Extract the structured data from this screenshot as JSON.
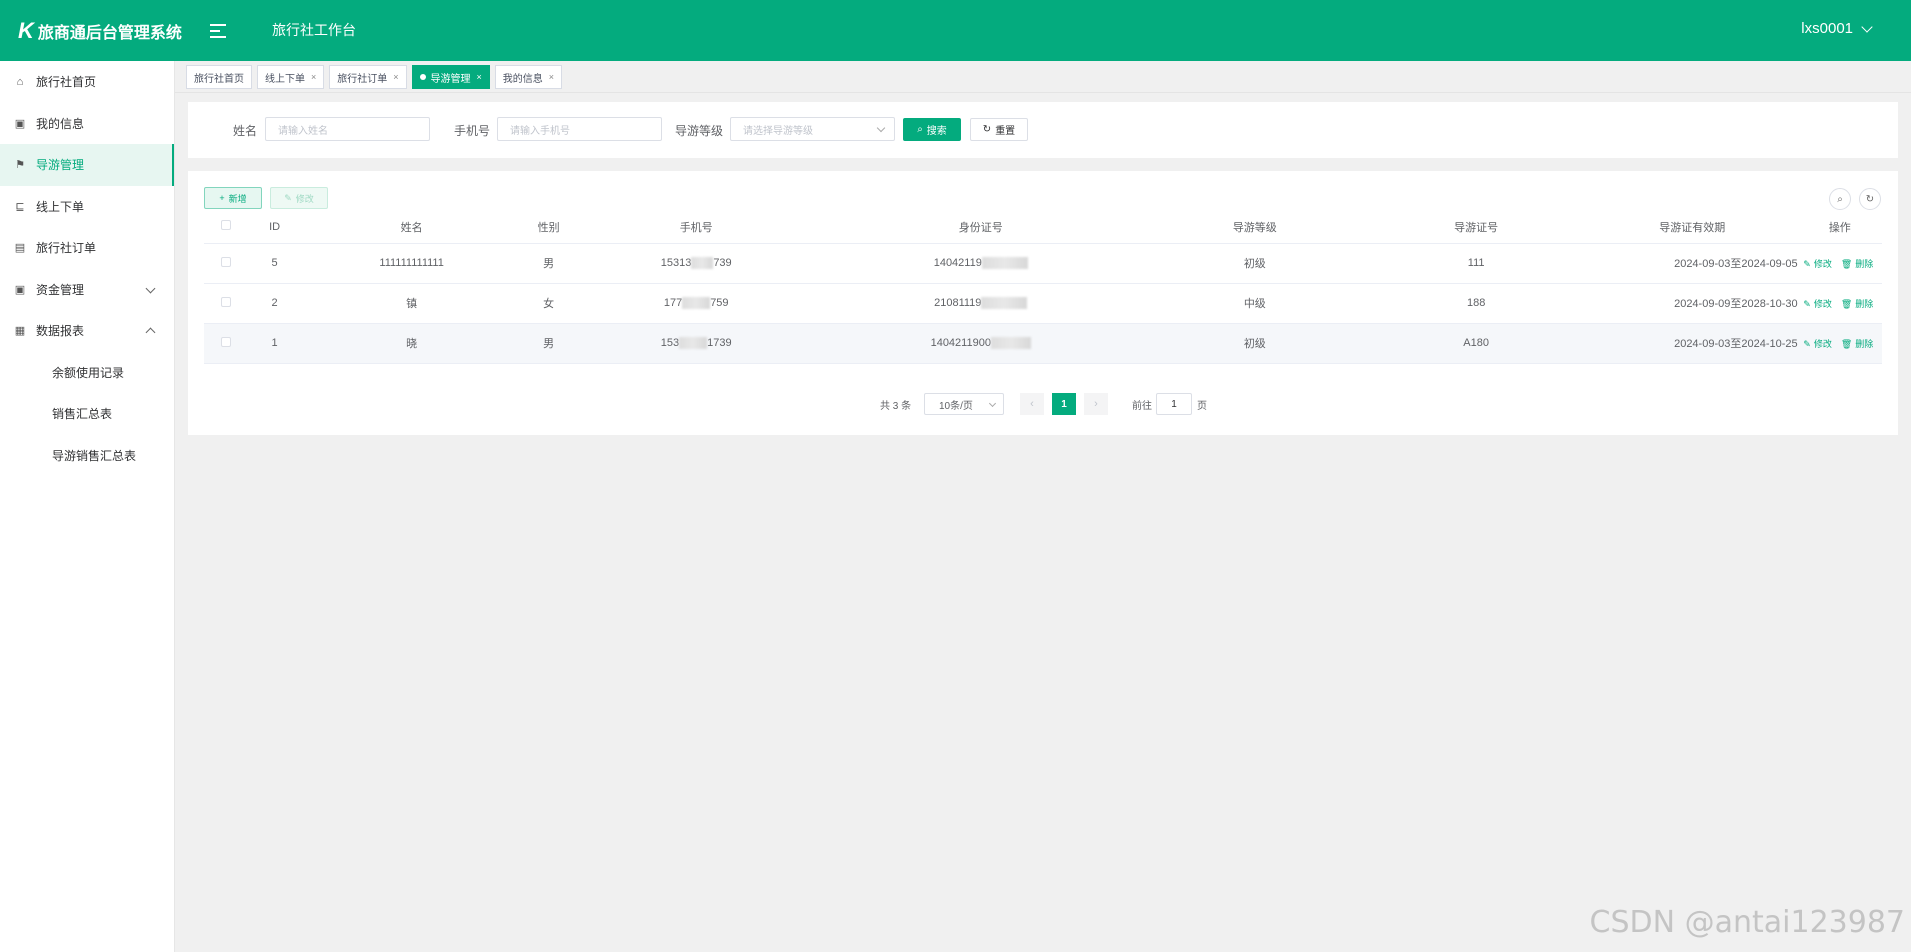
{
  "header": {
    "logo_mark": "K",
    "app_title": "旅商通后台管理系统",
    "workspace_title": "旅行社工作台",
    "username": "lxs0001"
  },
  "sidebar": {
    "items": [
      {
        "label": "旅行社首页",
        "icon": "home-icon"
      },
      {
        "label": "我的信息",
        "icon": "profile-icon"
      },
      {
        "label": "导游管理",
        "icon": "flag-icon",
        "active": true
      },
      {
        "label": "线上下单",
        "icon": "order-icon"
      },
      {
        "label": "旅行社订单",
        "icon": "clipboard-icon"
      },
      {
        "label": "资金管理",
        "icon": "wallet-icon",
        "expandable": true
      },
      {
        "label": "数据报表",
        "icon": "report-icon",
        "expanded": true
      }
    ],
    "sub_items": [
      "余额使用记录",
      "销售汇总表",
      "导游销售汇总表"
    ]
  },
  "tabs": [
    {
      "label": "旅行社首页"
    },
    {
      "label": "线上下单",
      "close": "×"
    },
    {
      "label": "旅行社订单",
      "close": "×"
    },
    {
      "label": "导游管理",
      "close": "×",
      "active": true
    },
    {
      "label": "我的信息",
      "close": "×"
    }
  ],
  "search": {
    "name_label": "姓名",
    "name_placeholder": "请输入姓名",
    "phone_label": "手机号",
    "phone_placeholder": "请输入手机号",
    "level_label": "导游等级",
    "level_placeholder": "请选择导游等级",
    "search_button": "搜索",
    "reset_button": "重置"
  },
  "toolbar": {
    "add_button": "新增",
    "edit_button": "修改"
  },
  "table": {
    "columns": [
      "ID",
      "姓名",
      "性别",
      "手机号",
      "身份证号",
      "导游等级",
      "导游证号",
      "导游证有效期",
      "操作"
    ],
    "rows": [
      {
        "id": "5",
        "name": "111111111111",
        "gender": "男",
        "phone": "15313",
        "phone_end": "739",
        "idcard": "14042119",
        "level": "初级",
        "license": "111",
        "validity": "2024-09-03至2024-09-05"
      },
      {
        "id": "2",
        "name": "镇",
        "gender": "女",
        "phone": "177",
        "phone_end": "759",
        "idcard": "21081119",
        "level": "中级",
        "license": "188",
        "validity": "2024-09-09至2028-10-30"
      },
      {
        "id": "1",
        "name": "晓",
        "gender": "男",
        "phone": "153",
        "phone_end": "1739",
        "idcard": "1404211900",
        "level": "初级",
        "license": "A180",
        "validity": "2024-09-03至2024-10-25"
      }
    ],
    "op_edit": "修改",
    "op_delete": "删除"
  },
  "pagination": {
    "total_text": "共 3 条",
    "page_size": "10条/页",
    "current_page": "1",
    "goto_label": "前往",
    "goto_value": "1",
    "page_unit": "页"
  },
  "watermark": "CSDN @antai123987",
  "colors": {
    "primary": "#04ab7e"
  }
}
